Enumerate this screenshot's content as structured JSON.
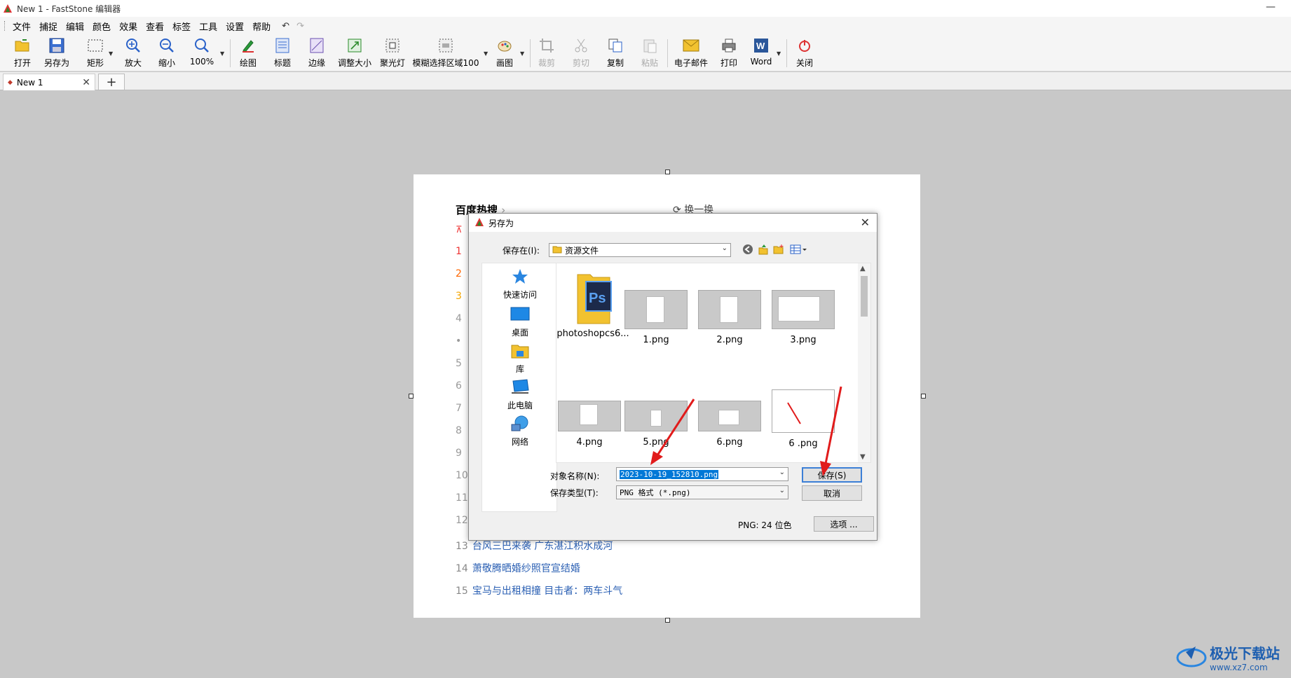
{
  "app": {
    "title": "New 1 - FastStone 编辑器"
  },
  "menu": [
    "文件",
    "捕捉",
    "编辑",
    "颜色",
    "效果",
    "查看",
    "标签",
    "工具",
    "设置",
    "帮助"
  ],
  "toolbar": {
    "open": "打开",
    "save_as": "另存为",
    "rect": "矩形",
    "zoom_in": "放大",
    "zoom_out": "缩小",
    "zoom_level": "100%",
    "draw": "绘图",
    "caption": "标题",
    "edge": "边缘",
    "resize": "调整大小",
    "spotlight": "聚光灯",
    "blur": "模糊选择区域100",
    "canvas": "画图",
    "crop": "裁剪",
    "cut": "剪切",
    "copy": "复制",
    "paste": "粘贴",
    "email": "电子邮件",
    "print": "打印",
    "word": "Word",
    "close": "关闭"
  },
  "tabs": {
    "active": "New 1",
    "add": "+"
  },
  "doc": {
    "heading": "百度热搜",
    "refresh": "换一换",
    "numbers": [
      "1",
      "2",
      "3",
      "4",
      "•",
      "5",
      "6",
      "7",
      "8",
      "9",
      "10",
      "11",
      "12"
    ],
    "rows": [
      {
        "n": "13",
        "text": "台风三巴来袭 广东湛江积水成河"
      },
      {
        "n": "14",
        "text": "萧敬腾晒婚纱照官宣结婚"
      },
      {
        "n": "15",
        "text": "宝马与出租相撞 目击者：两车斗气"
      }
    ]
  },
  "dialog": {
    "title": "另存为",
    "save_in_label": "保存在(I):",
    "save_in_value": "资源文件",
    "places": [
      {
        "label": "快速访问"
      },
      {
        "label": "桌面"
      },
      {
        "label": "库"
      },
      {
        "label": "此电脑"
      },
      {
        "label": "网络"
      }
    ],
    "files": [
      "photoshopcs6...",
      "1.png",
      "2.png",
      "3.png",
      "4.png",
      "5.png",
      "6.png",
      "6 .png"
    ],
    "filename_label": "对象名称(N):",
    "filename_value": "2023-10-19_152810.png",
    "filetype_label": "保存类型(T):",
    "filetype_value": "PNG 格式 (*.png)",
    "save_button": "保存(S)",
    "cancel_button": "取消",
    "format_info": "PNG: 24 位色",
    "options_button": "选项 ..."
  },
  "watermark": {
    "text": "极光下载站",
    "url": "www.xz7.com"
  },
  "colors": {
    "accent": "#0078d7",
    "annotation": "#e11b1b",
    "link": "#2a5fb3"
  }
}
